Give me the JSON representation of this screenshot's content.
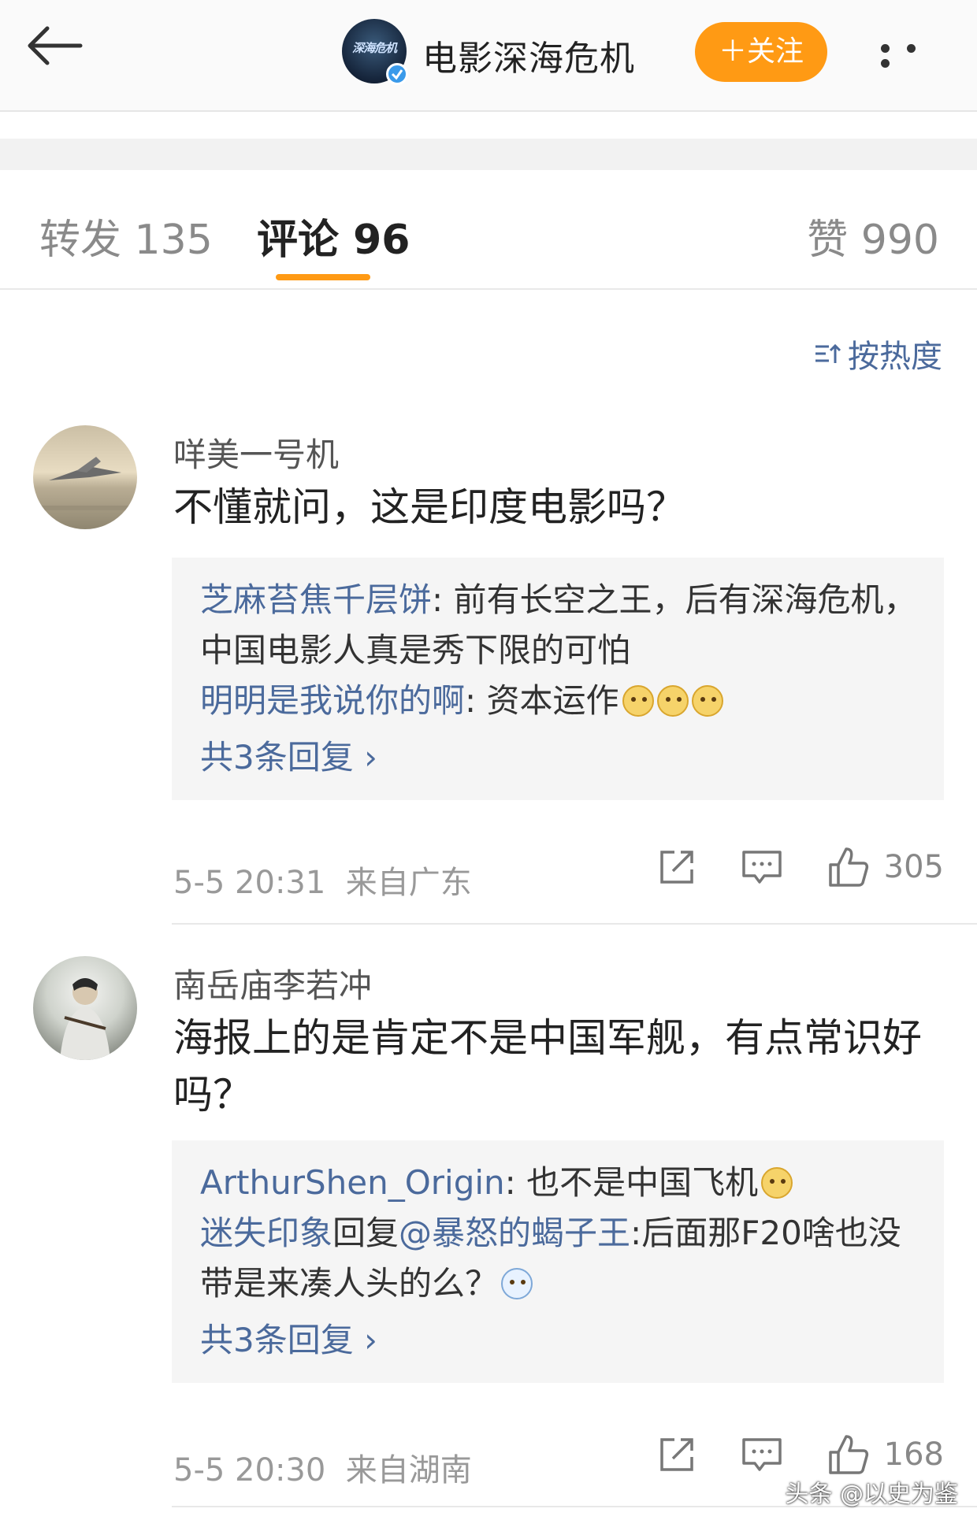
{
  "header": {
    "back_icon": "arrow-left-icon",
    "account_logo_text": "深海危机",
    "account_name": "电影深海危机",
    "follow_label": "＋关注",
    "more_icon": "more-dots-icon"
  },
  "tabs": [
    {
      "label": "转发 135"
    },
    {
      "label": "评论 96"
    },
    {
      "label": "赞 990"
    }
  ],
  "sort": {
    "label": "按热度"
  },
  "comments": [
    {
      "username": "咩美一号机",
      "text": "不懂就问，这是印度电影吗？",
      "replies": [
        {
          "name": "芝麻苔焦千层饼",
          "text": ": 前有长空之王，后有深海危机，中国电影人真是秀下限的可怕"
        },
        {
          "name": "明明是我说你的啊",
          "text": ": 资本运作"
        }
      ],
      "more_replies": "共3条回复 ›",
      "time": "5-5 20:31",
      "location": "来自广东",
      "likes": "305"
    },
    {
      "username": "南岳庙李若冲",
      "text": "海报上的是肯定不是中国军舰，有点常识好吗？",
      "replies": [
        {
          "name": "ArthurShen_Origin",
          "text": ": 也不是中国飞机"
        },
        {
          "name": "迷失印象",
          "mid": "回复",
          "name2": "@暴怒的蝎子王",
          "text": ":后面那F20啥也没带是来凑人头的么？"
        }
      ],
      "more_replies": "共3条回复 ›",
      "time": "5-5 20:30",
      "location": "来自湖南",
      "likes": "168"
    }
  ],
  "watermark": "头条 @以史为鉴",
  "colors": {
    "accent": "#ff9a14",
    "link": "#4b6a9c"
  }
}
